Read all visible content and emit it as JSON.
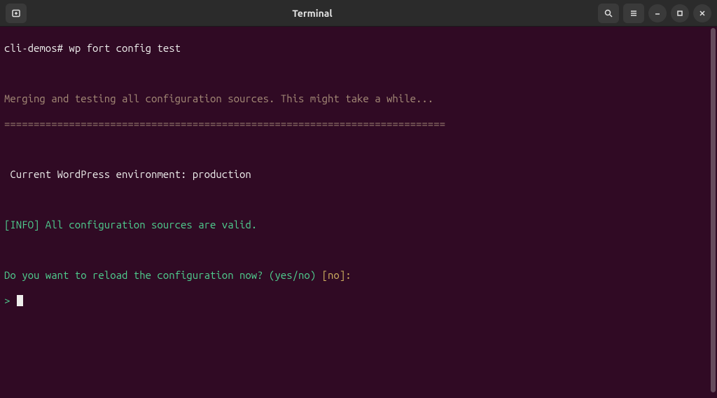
{
  "titlebar": {
    "title": "Terminal"
  },
  "terminal": {
    "prompt_host": "cli-demos#",
    "command": "wp fort config test",
    "merge_line": "Merging and testing all configuration sources. This might take a while...",
    "divider": "===========================================================================",
    "env_line": "Current WordPress environment: production",
    "info_line": "[INFO] All configuration sources are valid.",
    "question": "Do you want to reload the configuration now? (yes/no) ",
    "bracket_open": "[",
    "default_answer": "no",
    "bracket_close": "]:",
    "input_prompt": "> "
  }
}
